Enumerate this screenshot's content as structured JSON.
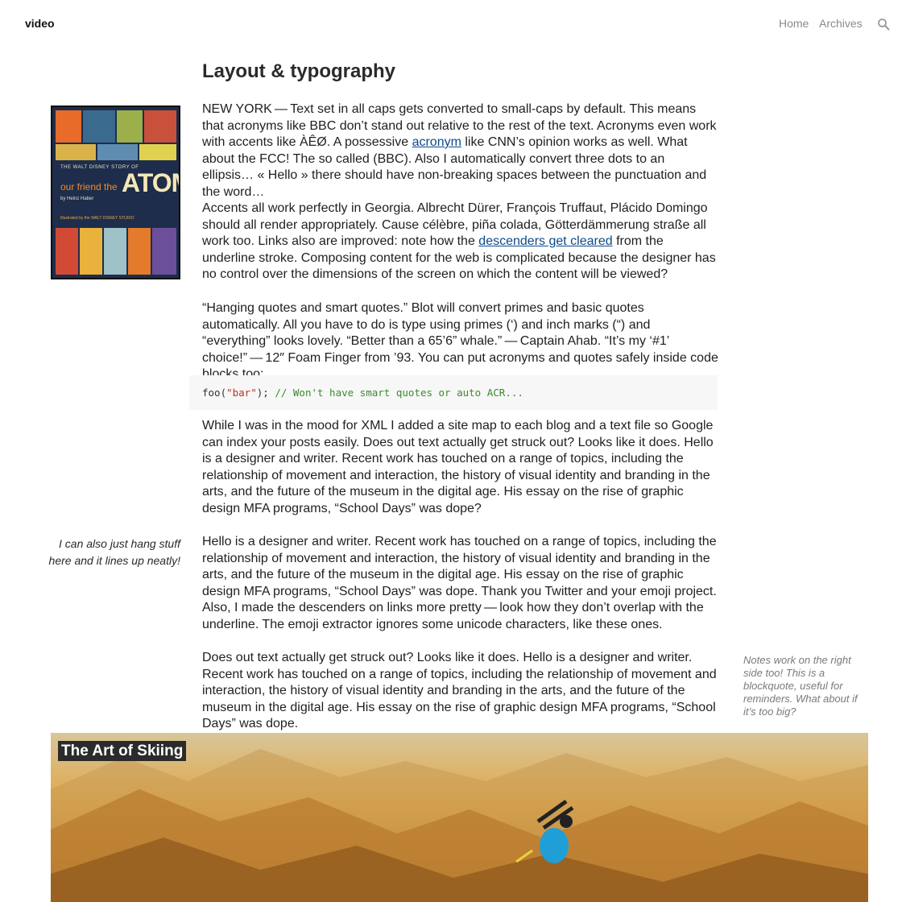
{
  "header": {
    "site_title": "video",
    "nav": {
      "home": "Home",
      "archives": "Archives"
    },
    "search_icon": "magnifier-icon"
  },
  "article": {
    "title": "Layout & typography",
    "paragraphs": {
      "p1": {
        "before_link": "NEW YORK — Text set in all caps gets converted to small-caps by default. This means that acronyms like BBC don’t stand out relative to the rest of the text. Acronyms even work with accents like ÀÊØ. A possessive ",
        "link": "acronym",
        "after_link": " like CNN’s opinion works as well. What about the FCC! The so called (BBC). Also I automatically convert three dots to an ellipsis… « Hello » there should have non-breaking spaces between the punctuation and the word…"
      },
      "p2": {
        "before_link": "Accents all work perfectly in Georgia. Albrecht Dürer, François Truffaut, Plácido Domingo should all render appropriately. Cause célèbre, piña colada, Götterdämmerung straße all work too. Links also are improved: note how the ",
        "link": "descenders get cleared",
        "after_link": " from the underline stroke. Composing content for the web is complicated because the designer has no control over the dimensions of the screen on which the content will be viewed?"
      },
      "p3": "“Hanging quotes and smart quotes.” Blot will convert primes and basic quotes automatically. All you have to do is type using primes (‘) and inch marks (“) and “everything” looks lovely. “Better than a 65’6” whale.” — Captain Ahab. “It’s my ‘#1’ choice!” — 12″ Foam Finger from ’93. You can put acronyms and quotes safely inside code blocks too:",
      "p4": "While I was in the mood for XML I added a site map to each blog and a text file so Google can index your posts easily. Does out text actually get struck out? Looks like it does. Hello is a designer and writer. Recent work has touched on a range of topics, including the relationship of movement and interaction, the history of visual identity and branding in the arts, and the future of the museum in the digital age. His essay on the rise of graphic design MFA programs, “School Days” was dope?",
      "p5": "Hello is a designer and writer. Recent work has touched on a range of topics, including the relationship of movement and interaction, the history of visual identity and branding in the arts, and the future of the museum in the digital age. His essay on the rise of graphic design MFA programs, “School Days” was dope. Thank you Twitter and your emoji project. Also, I made the descenders on links more pretty — look how they don’t overlap with the underline. The emoji extractor ignores some unicode characters, like these ones.",
      "p6": "Does out text actually get struck out? Looks like it does. Hello is a designer and writer. Recent work has touched on a range of topics, including the relationship of movement and interaction, the history of visual identity and branding in the arts, and the future of the museum in the digital age. His essay on the rise of graphic design MFA programs, “School Days” was dope."
    },
    "code": {
      "fn": "foo(",
      "str": "\"bar\"",
      "close": "); ",
      "comment": "// Won't have smart quotes or auto ACR..."
    },
    "book_cover": {
      "subtitle": "THE WALT DISNEY STORY OF",
      "title_small": "our friend the",
      "title": "ATOM",
      "author": "by Heinz Haber",
      "illustrated": "Illustrated by the WALT DISNEY STUDIO"
    },
    "side_note_left": "I can also just hang stuff here and it lines up neatly!",
    "side_note_right": "Notes work on the right side too! This is a blockquote, useful for reminders. What about if it’s too big?",
    "hero": {
      "title": "The Art of Skiing"
    }
  }
}
